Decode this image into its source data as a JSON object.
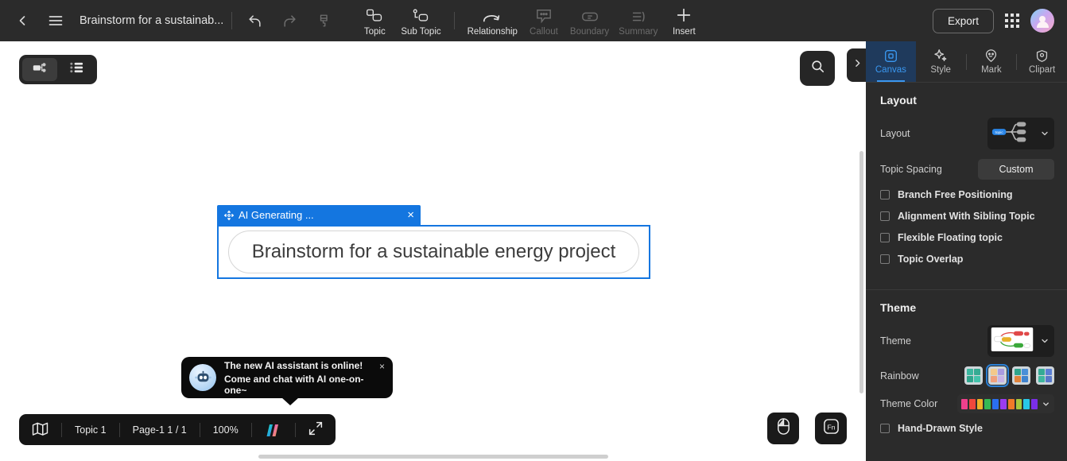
{
  "topbar": {
    "back_icon": "chevron-left-icon",
    "menu_icon": "hamburger-menu-icon",
    "doc_title": "Brainstorm for a sustainab...",
    "undo_icon": "undo-icon",
    "redo_icon": "redo-icon",
    "format_painter_icon": "format-painter-icon",
    "tools": [
      {
        "label": "Topic",
        "icon": "topic-icon",
        "enabled": true
      },
      {
        "label": "Sub Topic",
        "icon": "sub-topic-icon",
        "enabled": true
      },
      {
        "label": "Relationship",
        "icon": "relationship-arc-icon",
        "enabled": true
      },
      {
        "label": "Callout",
        "icon": "callout-icon",
        "enabled": false
      },
      {
        "label": "Boundary",
        "icon": "boundary-icon",
        "enabled": false
      },
      {
        "label": "Summary",
        "icon": "summary-icon",
        "enabled": false
      },
      {
        "label": "Insert",
        "icon": "plus-icon",
        "enabled": true
      }
    ],
    "export_label": "Export",
    "apps_icon": "app-grid-icon",
    "avatar_icon": "user-avatar"
  },
  "canvas": {
    "view_toggle": {
      "mindmap_icon": "mindmap-view-icon",
      "outline_icon": "outline-view-icon",
      "active": "mindmap"
    },
    "search_icon": "search-icon",
    "panel_collapse_icon": "chevron-right-icon",
    "ai_card": {
      "move_icon": "move-handle-icon",
      "title": "AI Generating ...",
      "close_label": "×",
      "topic_text": "Brainstorm for a sustainable energy project"
    },
    "ai_toast": {
      "bot_icon": "robot-avatar-icon",
      "line1": "The new AI assistant is online!",
      "line2": "Come and chat with AI one-on-one~",
      "close_label": "×"
    },
    "float_buttons": [
      {
        "name": "mouse-mode-button",
        "icon": "mouse-icon"
      },
      {
        "name": "fn-shortcuts-button",
        "icon": "fn-key-icon"
      }
    ]
  },
  "statusbar": {
    "map_icon": "map-overview-icon",
    "topic_count": "Topic 1",
    "page": "Page-1   1 / 1",
    "zoom": "100%",
    "brand_icon": "brand-logo-icon",
    "fullscreen_icon": "fullscreen-icon"
  },
  "right_panel": {
    "tabs": [
      {
        "label": "Canvas",
        "icon": "canvas-icon",
        "active": true
      },
      {
        "label": "Style",
        "icon": "sparkle-style-icon",
        "active": false
      },
      {
        "label": "Mark",
        "icon": "mark-smiley-icon",
        "active": false
      },
      {
        "label": "Clipart",
        "icon": "clipart-icon",
        "active": false
      }
    ],
    "layout_section": {
      "heading": "Layout",
      "layout_label": "Layout",
      "layout_thumb_icon": "map-layout-thumbnail",
      "layout_caret_icon": "chevron-down-icon",
      "topic_spacing_label": "Topic Spacing",
      "topic_spacing_value": "Custom",
      "checkboxes": [
        {
          "label": "Branch Free Positioning",
          "checked": false
        },
        {
          "label": "Alignment With Sibling Topic",
          "checked": false
        },
        {
          "label": "Flexible Floating topic",
          "checked": false
        },
        {
          "label": "Topic Overlap",
          "checked": false
        }
      ]
    },
    "theme_section": {
      "heading": "Theme",
      "theme_label": "Theme",
      "theme_thumb_icon": "theme-preview-thumbnail",
      "theme_caret_icon": "chevron-down-icon",
      "rainbow_label": "Rainbow",
      "rainbow_options": [
        {
          "selected": false,
          "colors": [
            "#3bb8a0",
            "#35ab93",
            "#2fa58c",
            "#43c3ab"
          ]
        },
        {
          "selected": true,
          "colors": [
            "#f3c98b",
            "#a99be0",
            "#f0a07c",
            "#c8b3e8"
          ]
        },
        {
          "selected": false,
          "colors": [
            "#2fa58c",
            "#4a8fd8",
            "#e0833c",
            "#3f83cf"
          ]
        },
        {
          "selected": false,
          "colors": [
            "#34ab94",
            "#5b7fd4",
            "#3fb79f",
            "#5878c9"
          ]
        }
      ],
      "theme_color_label": "Theme Color",
      "theme_colors": [
        "#f0408c",
        "#f0483c",
        "#f0b228",
        "#34b855",
        "#2a6ff0",
        "#9b3cf0",
        "#f07a28",
        "#a8c83c",
        "#28c8e8",
        "#7a2ee8"
      ],
      "theme_color_caret_icon": "chevron-down-icon",
      "hand_drawn": {
        "label": "Hand-Drawn Style",
        "checked": false
      }
    }
  },
  "colors": {
    "topbar_bg": "#2b2b2b",
    "panel_bg": "#2b2b2b",
    "accent_blue": "#3a97f0",
    "card_blue": "#1476e0",
    "canvas_bg": "#ffffff"
  }
}
